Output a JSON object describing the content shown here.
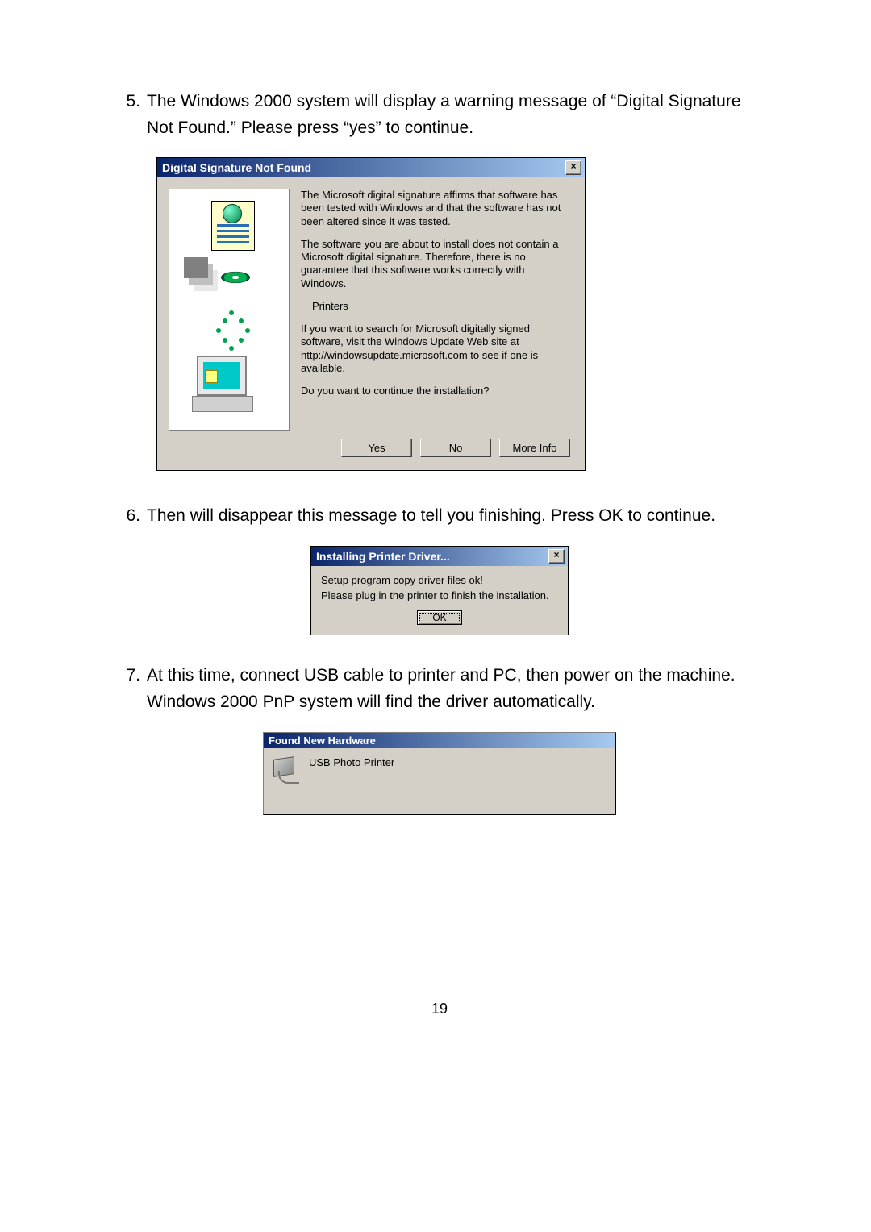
{
  "steps": {
    "s5": {
      "num": "5.",
      "text": "The Windows 2000 system will display a warning message of “Digital Signature Not Found.” Please press “yes” to continue."
    },
    "s6": {
      "num": "6.",
      "text": "Then will disappear this message to tell you finishing. Press OK to continue."
    },
    "s7": {
      "num": "7.",
      "text": "At this time, connect USB cable to printer and PC, then power on the machine. Windows 2000 PnP system will find the driver automatically."
    }
  },
  "dlg1": {
    "title": "Digital Signature Not Found",
    "close": "×",
    "para1": "The Microsoft digital signature affirms that software has been tested with Windows and that the software has not been altered since it was tested.",
    "para2": "The software you are about to install does not contain a Microsoft digital signature. Therefore,  there is no guarantee that this software works correctly with Windows.",
    "printers": "Printers",
    "para3": "If you want to search for Microsoft digitally signed software, visit the Windows Update Web site at http://windowsupdate.microsoft.com to see if one is available.",
    "para4": "Do you want to continue the installation?",
    "btn_yes": "Yes",
    "btn_no": "No",
    "btn_more": "More Info"
  },
  "dlg2": {
    "title": "Installing Printer Driver...",
    "close": "×",
    "line1": "Setup program copy driver files ok!",
    "line2": "Please plug in the printer to finish the installation.",
    "btn_ok": "OK"
  },
  "dlg3": {
    "title": "Found New Hardware",
    "device": "USB Photo Printer"
  },
  "page_number": "19"
}
